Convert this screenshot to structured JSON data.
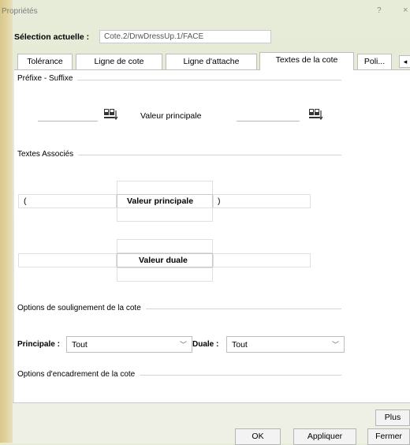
{
  "window": {
    "title": "Propriétés",
    "help_label": "?",
    "close_label": "×"
  },
  "selection": {
    "label": "Sélection actuelle :",
    "value": "Cote.2/DrwDressUp.1/FACE"
  },
  "tabs": [
    {
      "label": "Tolérance",
      "active": false
    },
    {
      "label": "Ligne de cote",
      "active": false
    },
    {
      "label": "Ligne d'attache",
      "active": false
    },
    {
      "label": "Textes de la cote",
      "active": true
    },
    {
      "label": "Poli...",
      "active": false
    }
  ],
  "tab_scroll_label": "◂",
  "prefix_suffix": {
    "group_title": "Préfixe - Suffixe",
    "main_value_label": "Valeur principale",
    "icon": "text-insert-icon"
  },
  "associated_texts": {
    "group_title": "Textes Associés",
    "main_value_label": "Valeur principale",
    "dual_value_label": "Valeur duale",
    "left_bracket": "(",
    "right_bracket": ")"
  },
  "underline_options": {
    "group_title": "Options de soulignement de la cote",
    "main_label": "Principale :",
    "main_value": "Tout",
    "dual_label": "Duale :",
    "dual_value": "Tout"
  },
  "frame_options": {
    "group_title": "Options d'encadrement de la cote"
  },
  "buttons": {
    "more": "Plus",
    "ok": "OK",
    "apply": "Appliquer",
    "close": "Fermer"
  }
}
